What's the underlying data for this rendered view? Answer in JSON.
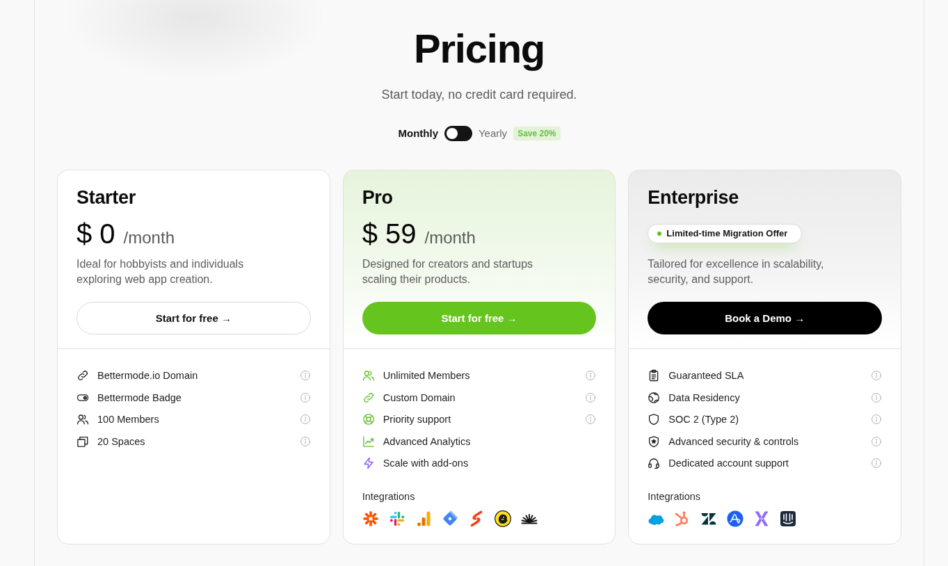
{
  "header": {
    "title": "Pricing",
    "subtitle": "Start today, no credit card required."
  },
  "billing": {
    "left_label": "Monthly",
    "right_label": "Yearly",
    "on": false,
    "badge": "Save 20%"
  },
  "plans": [
    {
      "kind": "basic",
      "name": "Starter",
      "price": "$ 0",
      "period": "/month",
      "description": "Ideal for hobbyists and individuals exploring web app creation.",
      "button": {
        "label": "Start for free →",
        "kind": "outline"
      },
      "features": [
        {
          "kind": "link",
          "label": "Bettermode.io Domain",
          "info": true
        },
        {
          "kind": "toggle",
          "label": "Bettermode Badge",
          "info": true
        },
        {
          "kind": "members",
          "label": "100 Members",
          "info": true
        },
        {
          "kind": "spaces",
          "label": "20 Spaces",
          "info": true
        }
      ]
    },
    {
      "kind": "featured",
      "name": "Pro",
      "price": "$ 59",
      "period": "/month",
      "description": "Designed for creators and startups scaling their products.",
      "button": {
        "label": "Start for free →",
        "kind": "primary"
      },
      "features": [
        {
          "kind": "members",
          "label": "Unlimited Members",
          "info": true
        },
        {
          "kind": "link",
          "label": "Custom Domain",
          "info": true
        },
        {
          "kind": "lifebuoy",
          "label": "Priority support",
          "info": true
        },
        {
          "kind": "chart",
          "label": "Advanced Analytics",
          "info": false
        },
        {
          "kind": "bolt",
          "label": "Scale with add-ons",
          "info": false
        }
      ],
      "integrations": {
        "label": "Integrations",
        "logos": [
          {
            "kind": "asterisk"
          },
          {
            "kind": "hash"
          },
          {
            "kind": "bars"
          },
          {
            "kind": "diamond"
          },
          {
            "kind": "zigzag"
          },
          {
            "kind": "mascot"
          },
          {
            "kind": "sunburst"
          }
        ]
      }
    },
    {
      "kind": "enterprise",
      "name": "Enterprise",
      "offer": "Limited-time Migration Offer",
      "description": "Tailored for excellence in scalability, security, and support.",
      "button": {
        "label": "Book a Demo →",
        "kind": "dark"
      },
      "features": [
        {
          "kind": "clipboard",
          "label": "Guaranteed SLA",
          "info": true
        },
        {
          "kind": "globe",
          "label": "Data Residency",
          "info": true
        },
        {
          "kind": "shield",
          "label": "SOC 2 (Type 2)",
          "info": true
        },
        {
          "kind": "shieldstar",
          "label": "Advanced security & controls",
          "info": true
        },
        {
          "kind": "headset",
          "label": "Dedicated account support",
          "info": true
        }
      ],
      "integrations": {
        "label": "Integrations",
        "logos": [
          {
            "kind": "cloud"
          },
          {
            "kind": "sprocket"
          },
          {
            "kind": "triangles"
          },
          {
            "kind": "circle"
          },
          {
            "kind": "cross"
          },
          {
            "kind": "tile"
          }
        ]
      }
    }
  ]
}
